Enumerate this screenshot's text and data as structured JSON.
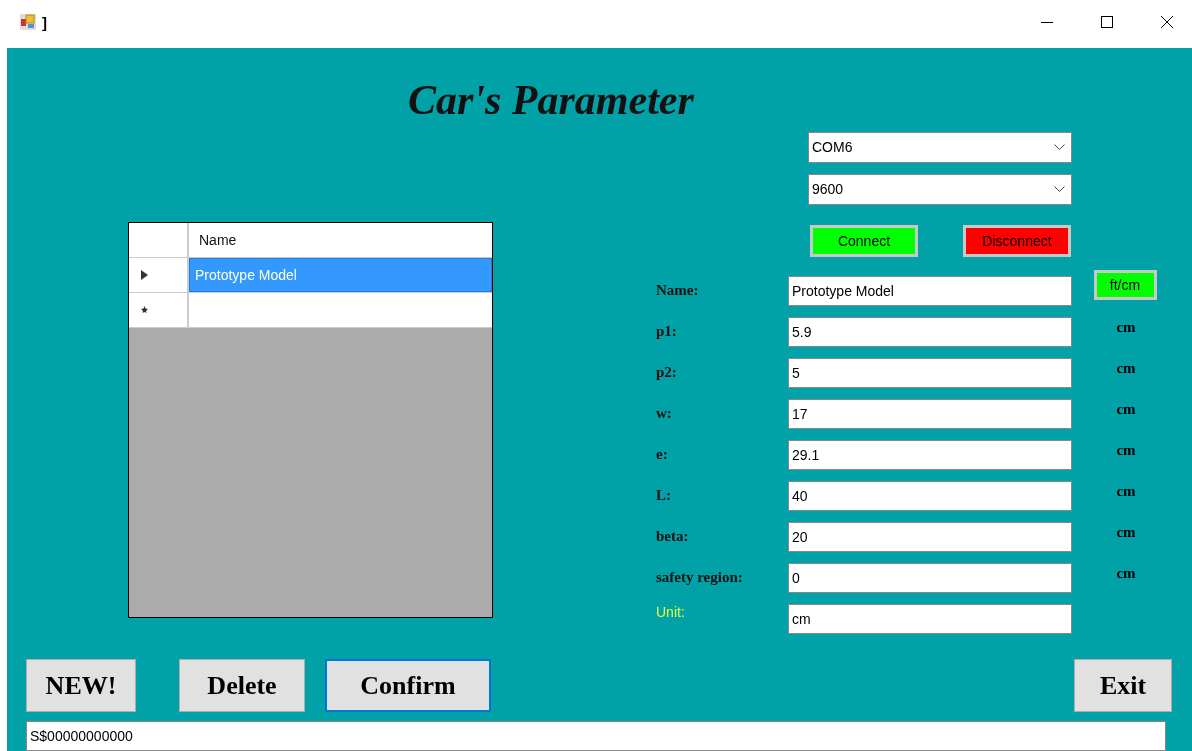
{
  "window": {
    "title": "]"
  },
  "heading": "Car's Parameter",
  "grid": {
    "columns": [
      "Name"
    ],
    "rows": [
      {
        "kind": "current",
        "name": "Prototype Model",
        "selected": true
      },
      {
        "kind": "new",
        "selected": false
      }
    ]
  },
  "port": {
    "value": "COM6"
  },
  "baud": {
    "value": "9600"
  },
  "connect_button": "Connect",
  "disconnect_button": "Disconnect",
  "unit_toggle": "ft/cm",
  "fields": [
    {
      "kind": "name",
      "label": "Name:",
      "value": "Prototype Model"
    },
    {
      "kind": "measure",
      "label": "p1:",
      "value": "5.9",
      "unit": "cm"
    },
    {
      "kind": "measure",
      "label": "p2:",
      "value": "5",
      "unit": "cm"
    },
    {
      "kind": "measure",
      "label": "w:",
      "value": "17",
      "unit": "cm"
    },
    {
      "kind": "measure",
      "label": "e:",
      "value": "29.1",
      "unit": "cm"
    },
    {
      "kind": "measure",
      "label": "L:",
      "value": "40",
      "unit": "cm"
    },
    {
      "kind": "measure",
      "label": "beta:",
      "value": "20",
      "unit": "cm"
    },
    {
      "kind": "measure",
      "label": "safety region:",
      "value": "0",
      "unit": "cm"
    },
    {
      "kind": "unit",
      "label": "Unit:",
      "value": "cm"
    }
  ],
  "buttons": [
    {
      "label": "NEW!",
      "focused": false
    },
    {
      "label": "Delete",
      "focused": false
    },
    {
      "label": "Confirm",
      "focused": true
    }
  ],
  "exit_button": "Exit",
  "status": {
    "value": "S$00000000000"
  }
}
